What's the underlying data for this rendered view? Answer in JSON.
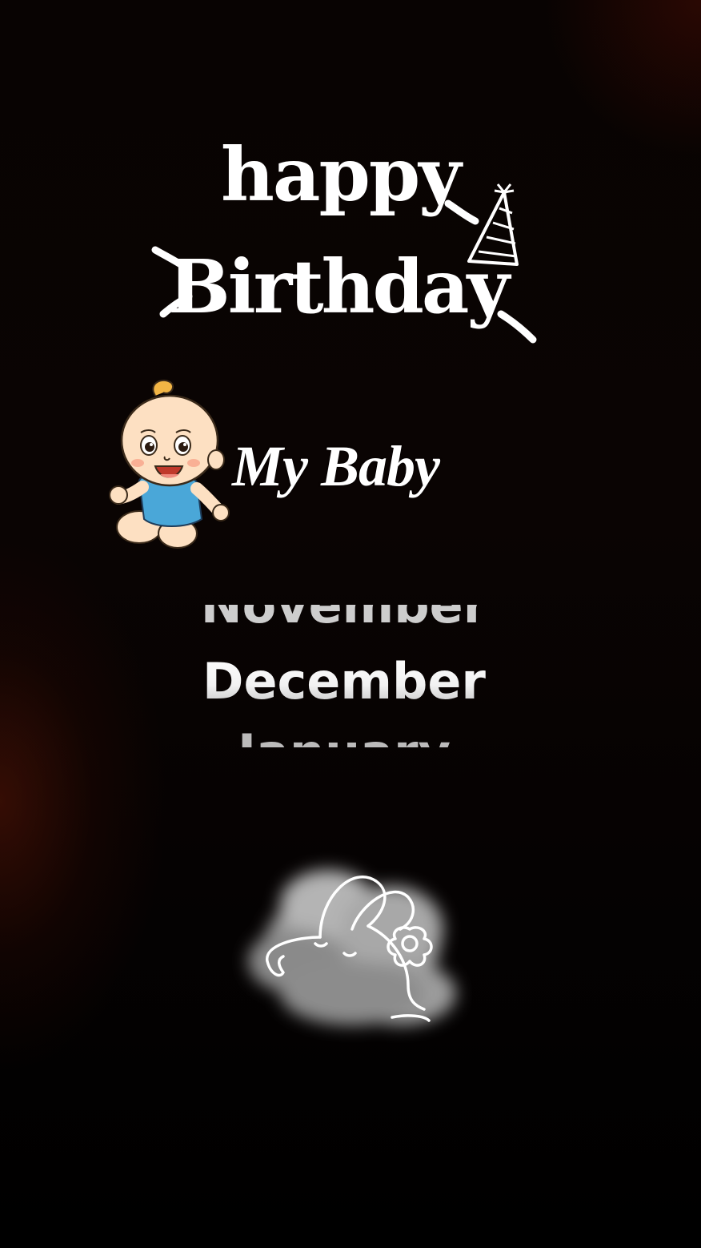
{
  "title": {
    "line1": "happy",
    "line2": "Birthday"
  },
  "name": {
    "text": "My Baby"
  },
  "month_picker": {
    "previous": "November",
    "selected": "December",
    "next": "January"
  },
  "icons": {
    "party_hat": "party-hat-icon",
    "baby": "baby-cartoon",
    "sticker": "cloud-bunny-sticker"
  },
  "colors": {
    "background": "#050202",
    "glow": "#5c1606",
    "text": "#ffffff",
    "baby_shirt": "#4aa7d8",
    "baby_skin": "#fde0c2",
    "baby_hair": "#f2b545"
  }
}
